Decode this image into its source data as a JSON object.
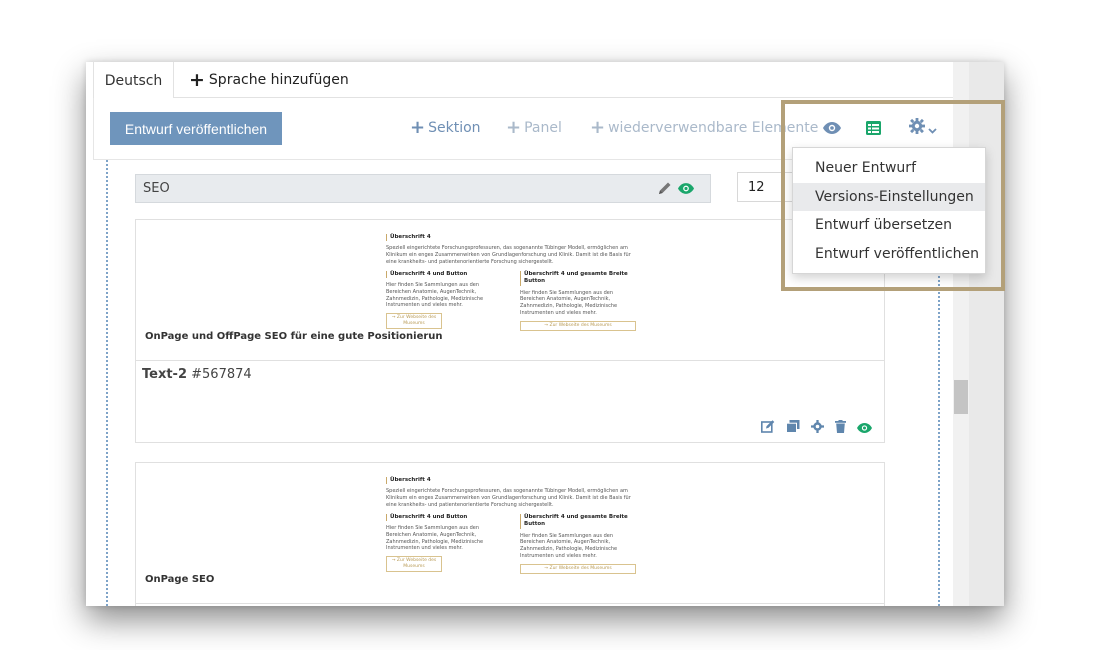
{
  "tabs": {
    "active_label": "Deutsch",
    "add_label": "Sprache hinzufügen"
  },
  "toolbar": {
    "publish_label": "Entwurf veröffentlichen",
    "add_section_label": "Sektion",
    "add_panel_label": "Panel",
    "add_reusable_label": "wiederverwendbare Elemente",
    "icons": [
      "eye-icon",
      "table-icon",
      "gear-icon",
      "chevron-down-icon"
    ],
    "accent_color": "#6f95bc",
    "green_color": "#1aa66b"
  },
  "fields": {
    "seo_label": "SEO",
    "column_value": "12"
  },
  "cards": [
    {
      "preview": {
        "heading": "Überschrift 4",
        "intro": "Speziell eingerichtete Forschungsprofessuren, das sogenannte Tübinger Modell, ermöglichen am Klinikum ein enges Zusammenwirken von Grundlagenforschung und Klinik. Damit ist die Basis für eine krankheits- und patientenorientierte Forschung sichergestellt.",
        "col1_heading": "Überschrift 4 und Button",
        "col1_text": "Hier finden Sie Sammlungen aus den Bereichen Anatomie, AugenTechnik, Zahnmedizin, Pathologie, Medizinische Instrumenten und vieles mehr.",
        "col2_heading": "Überschrift 4 und gesamte Breite Button",
        "col2_text": "Hier finden Sie Sammlungen aus den Bereichen Anatomie, AugenTechnik, Zahnmedizin, Pathologie, Medizinische Instrumenten und vieles mehr.",
        "button_text": "→ Zur Webseite des Museums"
      },
      "caption": "OnPage und OffPage SEO für eine gute Positionierun",
      "element_name": "Text-2",
      "element_id": "#567874"
    },
    {
      "preview": {
        "heading": "Überschrift 4",
        "intro": "Speziell eingerichtete Forschungsprofessuren, das sogenannte Tübinger Modell, ermöglichen am Klinikum ein enges Zusammenwirken von Grundlagenforschung und Klinik. Damit ist die Basis für eine krankheits- und patientenorientierte Forschung sichergestellt.",
        "col1_heading": "Überschrift 4 und Button",
        "col1_text": "Hier finden Sie Sammlungen aus den Bereichen Anatomie, AugenTechnik, Zahnmedizin, Pathologie, Medizinische Instrumenten und vieles mehr.",
        "col2_heading": "Überschrift 4 und gesamte Breite Button",
        "col2_text": "Hier finden Sie Sammlungen aus den Bereichen Anatomie, AugenTechnik, Zahnmedizin, Pathologie, Medizinische Instrumenten und vieles mehr.",
        "button_text": "→ Zur Webseite des Museums"
      },
      "caption": "OnPage SEO"
    }
  ],
  "card_action_icons": [
    "edit-icon",
    "copy-icon",
    "gear-icon",
    "trash-icon",
    "eye-icon"
  ],
  "menu": {
    "items": [
      {
        "label": "Neuer Entwurf"
      },
      {
        "label": "Versions-Einstellungen"
      },
      {
        "label": "Entwurf übersetzen"
      },
      {
        "label": "Entwurf veröffentlichen"
      }
    ],
    "highlight_color": "#b3a079"
  }
}
